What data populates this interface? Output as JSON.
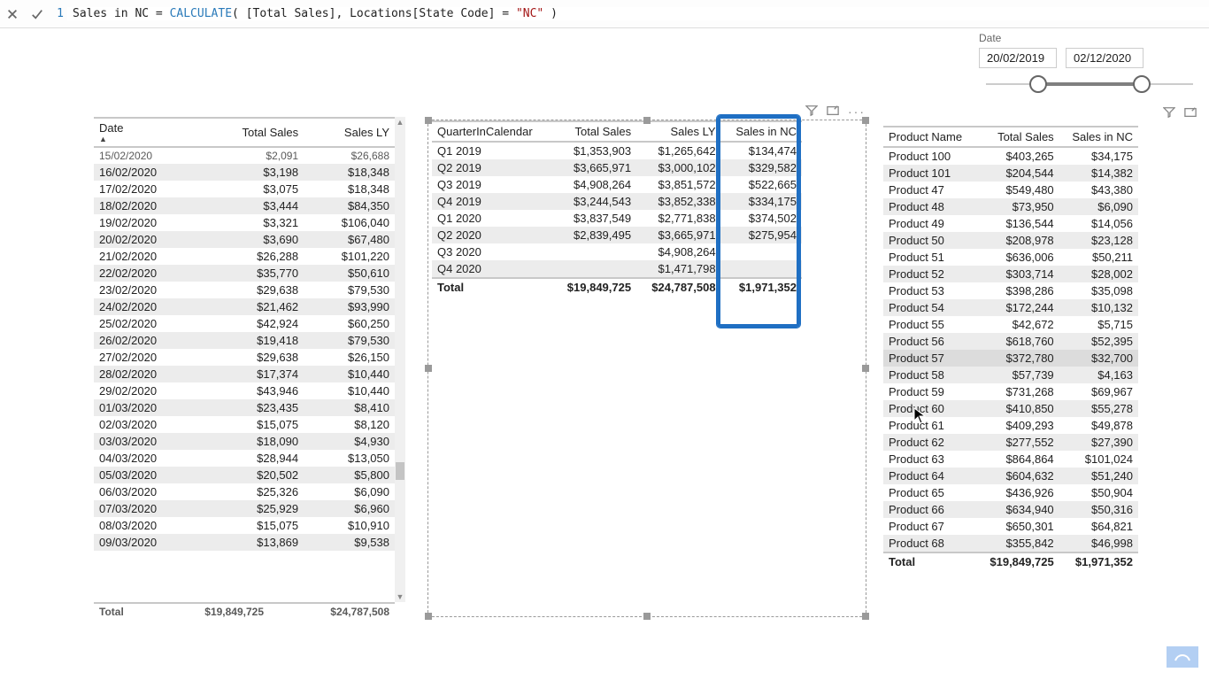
{
  "formula": {
    "line": "1",
    "prefix": "Sales in NC = ",
    "func": "CALCULATE",
    "open": "( ",
    "arg1": "[Total Sales]",
    "sep": ", ",
    "arg2a": "Locations[State Code] = ",
    "arg2b": "\"NC\"",
    "close": " )"
  },
  "slicer": {
    "title": "Date",
    "start": "20/02/2019",
    "end": "02/12/2020"
  },
  "date_table": {
    "headers": [
      "Date",
      "Total Sales",
      "Sales LY"
    ],
    "rows": [
      [
        "15/02/2020",
        "$2,091",
        "$26,688"
      ],
      [
        "16/02/2020",
        "$3,198",
        "$18,348"
      ],
      [
        "17/02/2020",
        "$3,075",
        "$18,348"
      ],
      [
        "18/02/2020",
        "$3,444",
        "$84,350"
      ],
      [
        "19/02/2020",
        "$3,321",
        "$106,040"
      ],
      [
        "20/02/2020",
        "$3,690",
        "$67,480"
      ],
      [
        "21/02/2020",
        "$26,288",
        "$101,220"
      ],
      [
        "22/02/2020",
        "$35,770",
        "$50,610"
      ],
      [
        "23/02/2020",
        "$29,638",
        "$79,530"
      ],
      [
        "24/02/2020",
        "$21,462",
        "$93,990"
      ],
      [
        "25/02/2020",
        "$42,924",
        "$60,250"
      ],
      [
        "26/02/2020",
        "$19,418",
        "$79,530"
      ],
      [
        "27/02/2020",
        "$29,638",
        "$26,150"
      ],
      [
        "28/02/2020",
        "$17,374",
        "$10,440"
      ],
      [
        "29/02/2020",
        "$43,946",
        "$10,440"
      ],
      [
        "01/03/2020",
        "$23,435",
        "$8,410"
      ],
      [
        "02/03/2020",
        "$15,075",
        "$8,120"
      ],
      [
        "03/03/2020",
        "$18,090",
        "$4,930"
      ],
      [
        "04/03/2020",
        "$28,944",
        "$13,050"
      ],
      [
        "05/03/2020",
        "$20,502",
        "$5,800"
      ],
      [
        "06/03/2020",
        "$25,326",
        "$6,090"
      ],
      [
        "07/03/2020",
        "$25,929",
        "$6,960"
      ],
      [
        "08/03/2020",
        "$15,075",
        "$10,910"
      ],
      [
        "09/03/2020",
        "$13,869",
        "$9,538"
      ]
    ],
    "total": [
      "Total",
      "$19,849,725",
      "$24,787,508"
    ]
  },
  "quarter_table": {
    "headers": [
      "QuarterInCalendar",
      "Total Sales",
      "Sales LY",
      "Sales in NC"
    ],
    "rows": [
      [
        "Q1 2019",
        "$1,353,903",
        "$1,265,642",
        "$134,474"
      ],
      [
        "Q2 2019",
        "$3,665,971",
        "$3,000,102",
        "$329,582"
      ],
      [
        "Q3 2019",
        "$4,908,264",
        "$3,851,572",
        "$522,665"
      ],
      [
        "Q4 2019",
        "$3,244,543",
        "$3,852,338",
        "$334,175"
      ],
      [
        "Q1 2020",
        "$3,837,549",
        "$2,771,838",
        "$374,502"
      ],
      [
        "Q2 2020",
        "$2,839,495",
        "$3,665,971",
        "$275,954"
      ],
      [
        "Q3 2020",
        "",
        "$4,908,264",
        ""
      ],
      [
        "Q4 2020",
        "",
        "$1,471,798",
        ""
      ]
    ],
    "total": [
      "Total",
      "$19,849,725",
      "$24,787,508",
      "$1,971,352"
    ]
  },
  "product_table": {
    "headers": [
      "Product Name",
      "Total Sales",
      "Sales in NC"
    ],
    "rows": [
      [
        "Product 100",
        "$403,265",
        "$34,175"
      ],
      [
        "Product 101",
        "$204,544",
        "$14,382"
      ],
      [
        "Product 47",
        "$549,480",
        "$43,380"
      ],
      [
        "Product 48",
        "$73,950",
        "$6,090"
      ],
      [
        "Product 49",
        "$136,544",
        "$14,056"
      ],
      [
        "Product 50",
        "$208,978",
        "$23,128"
      ],
      [
        "Product 51",
        "$636,006",
        "$50,211"
      ],
      [
        "Product 52",
        "$303,714",
        "$28,002"
      ],
      [
        "Product 53",
        "$398,286",
        "$35,098"
      ],
      [
        "Product 54",
        "$172,244",
        "$10,132"
      ],
      [
        "Product 55",
        "$42,672",
        "$5,715"
      ],
      [
        "Product 56",
        "$618,760",
        "$52,395"
      ],
      [
        "Product 57",
        "$372,780",
        "$32,700"
      ],
      [
        "Product 58",
        "$57,739",
        "$4,163"
      ],
      [
        "Product 59",
        "$731,268",
        "$69,967"
      ],
      [
        "Product 60",
        "$410,850",
        "$55,278"
      ],
      [
        "Product 61",
        "$409,293",
        "$49,878"
      ],
      [
        "Product 62",
        "$277,552",
        "$27,390"
      ],
      [
        "Product 63",
        "$864,864",
        "$101,024"
      ],
      [
        "Product 64",
        "$604,632",
        "$51,240"
      ],
      [
        "Product 65",
        "$436,926",
        "$50,904"
      ],
      [
        "Product 66",
        "$634,940",
        "$50,316"
      ],
      [
        "Product 67",
        "$650,301",
        "$64,821"
      ],
      [
        "Product 68",
        "$355,842",
        "$46,998"
      ]
    ],
    "total": [
      "Total",
      "$19,849,725",
      "$1,971,352"
    ],
    "hover_index": 12
  }
}
